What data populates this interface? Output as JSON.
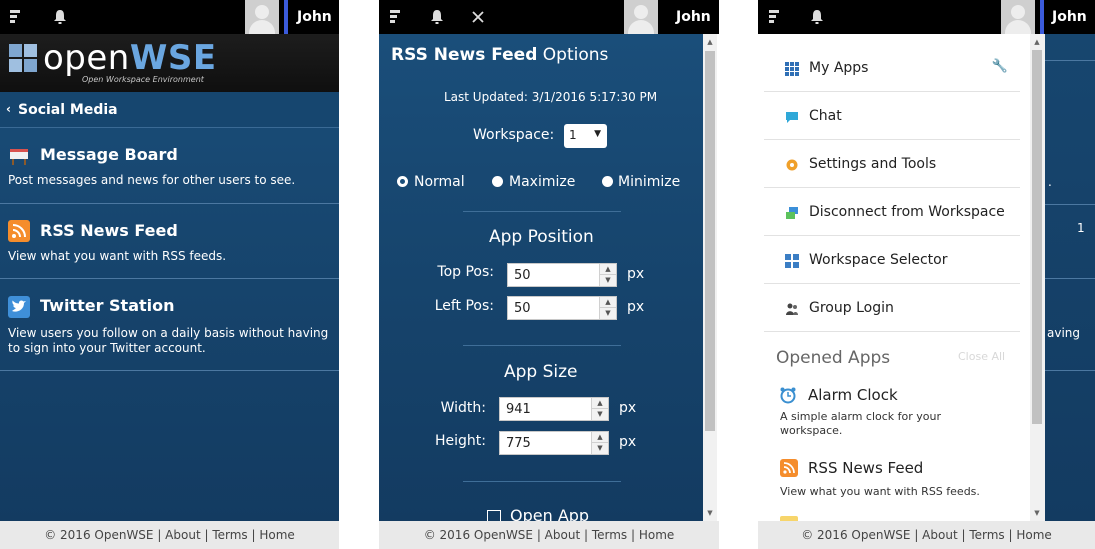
{
  "user": {
    "name": "John"
  },
  "footer": {
    "text": "© 2016 OpenWSE | About | Terms | Home"
  },
  "panel1": {
    "logo": {
      "text_light": "open",
      "text_bold": "WSE",
      "subtitle": "Open Workspace Environment"
    },
    "section": {
      "label": "Social Media"
    },
    "apps": [
      {
        "icon": "message-board-icon",
        "title": "Message Board",
        "description": "Post messages and news for other users to see."
      },
      {
        "icon": "rss-icon",
        "title": "RSS News Feed",
        "description": "View what you want with RSS feeds."
      },
      {
        "icon": "twitter-icon",
        "title": "Twitter Station",
        "description": "View users you follow on a daily basis without having to sign into your Twitter account."
      }
    ]
  },
  "panel2": {
    "title_bold": "RSS News Feed",
    "title_light": " Options",
    "last_updated": "Last Updated: 3/1/2016 5:17:30 PM",
    "workspace_label": "Workspace:",
    "workspace_value": "1",
    "modes": [
      "Normal",
      "Maximize",
      "Minimize"
    ],
    "position": {
      "title": "App Position",
      "top_label": "Top Pos:",
      "top_value": "50",
      "left_label": "Left Pos:",
      "left_value": "50",
      "unit": "px"
    },
    "size": {
      "title": "App Size",
      "width_label": "Width:",
      "width_value": "941",
      "height_label": "Height:",
      "height_value": "775",
      "unit": "px"
    },
    "open_app": "Open App"
  },
  "panel3": {
    "menu": [
      {
        "icon": "grid-icon",
        "label": "My Apps"
      },
      {
        "icon": "chat-icon",
        "label": "Chat"
      },
      {
        "icon": "gear-icon",
        "label": "Settings and Tools"
      },
      {
        "icon": "disconnect-icon",
        "label": "Disconnect from Workspace"
      },
      {
        "icon": "workspace-icon",
        "label": "Workspace Selector"
      },
      {
        "icon": "group-icon",
        "label": "Group Login"
      }
    ],
    "opened_apps_title": "Opened Apps",
    "close_all": "Close All",
    "opened_apps": [
      {
        "icon": "alarm-clock-icon",
        "title": "Alarm Clock",
        "description": "A simple alarm clock for your workspace."
      },
      {
        "icon": "rss-icon",
        "title": "RSS News Feed",
        "description": "View what you want with RSS feeds."
      }
    ],
    "behind_texts": [
      "1",
      "aving"
    ]
  },
  "colors": {
    "accent": "#3b5bdb",
    "navy": "#17466f",
    "rss_orange": "#f58d2c",
    "twitter_blue": "#3f8fd8"
  }
}
